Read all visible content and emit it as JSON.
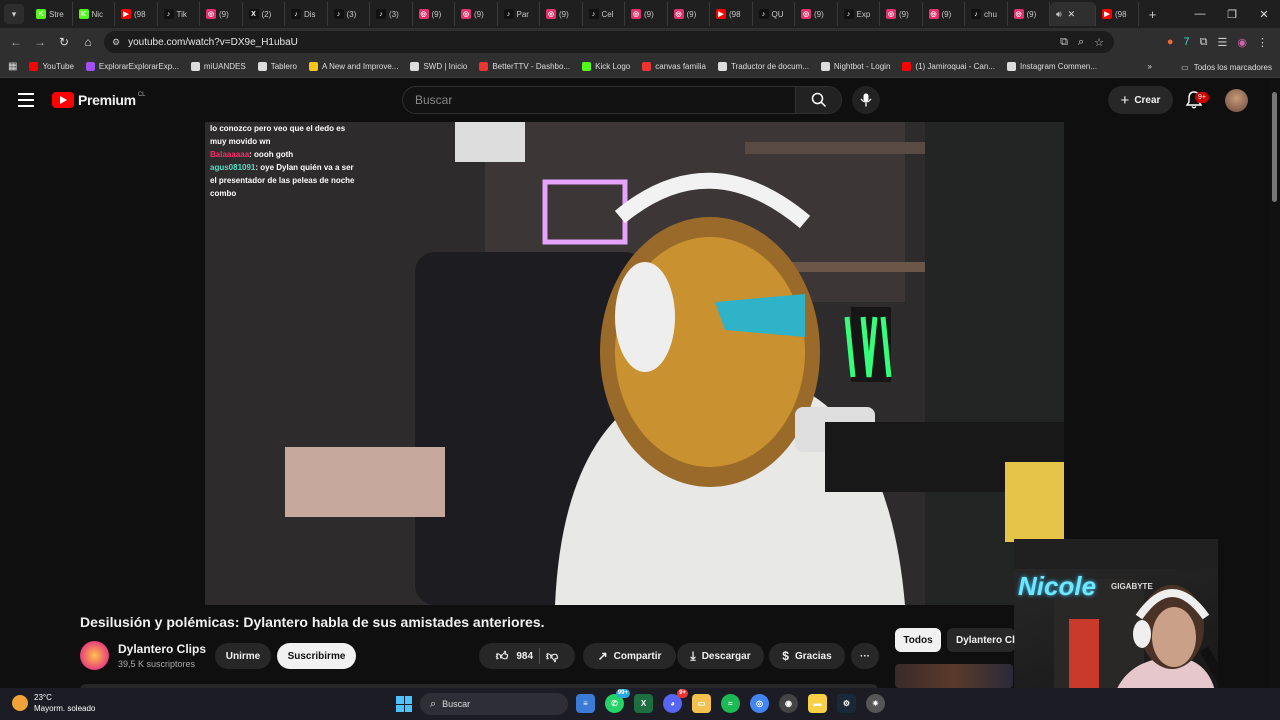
{
  "browser": {
    "tabs": [
      {
        "label": "Stre",
        "icon": "kick-icon",
        "color": "#53fc18"
      },
      {
        "label": "Nic",
        "icon": "kick-icon",
        "color": "#53fc18"
      },
      {
        "label": "(98",
        "icon": "youtube-icon",
        "color": "#ff0000"
      },
      {
        "label": "Tik",
        "icon": "tiktok-icon",
        "color": "#111111"
      },
      {
        "label": "(9)",
        "icon": "instagram-icon",
        "color": "#e1306c"
      },
      {
        "label": "(2)",
        "icon": "x-icon",
        "color": "#111111"
      },
      {
        "label": "Dis",
        "icon": "tiktok-icon",
        "color": "#111111"
      },
      {
        "label": "(3)",
        "icon": "tiktok-icon",
        "color": "#111111"
      },
      {
        "label": "(3)",
        "icon": "tiktok-icon",
        "color": "#111111"
      },
      {
        "label": "(9)",
        "icon": "instagram-icon",
        "color": "#e1306c"
      },
      {
        "label": "(9)",
        "icon": "instagram-icon",
        "color": "#e1306c"
      },
      {
        "label": "Par",
        "icon": "tiktok-icon",
        "color": "#111111"
      },
      {
        "label": "(9)",
        "icon": "instagram-icon",
        "color": "#e1306c"
      },
      {
        "label": "Cel",
        "icon": "tiktok-icon",
        "color": "#111111"
      },
      {
        "label": "(9)",
        "icon": "instagram-icon",
        "color": "#e1306c"
      },
      {
        "label": "(9)",
        "icon": "instagram-icon",
        "color": "#e1306c"
      },
      {
        "label": "(98",
        "icon": "youtube-icon",
        "color": "#ff0000"
      },
      {
        "label": "QU",
        "icon": "tiktok-icon",
        "color": "#111111"
      },
      {
        "label": "(9)",
        "icon": "instagram-icon",
        "color": "#e1306c"
      },
      {
        "label": "Exp",
        "icon": "tiktok-icon",
        "color": "#111111"
      },
      {
        "label": "(9)",
        "icon": "instagram-icon",
        "color": "#e1306c"
      },
      {
        "label": "(9)",
        "icon": "instagram-icon",
        "color": "#e1306c"
      },
      {
        "label": "chu",
        "icon": "tiktok-icon",
        "color": "#111111"
      },
      {
        "label": "(9)",
        "icon": "instagram-icon",
        "color": "#e1306c"
      }
    ],
    "active_tab_icon": "audio-icon",
    "last_tab": {
      "label": "(98",
      "icon": "youtube-icon",
      "color": "#ff0000"
    },
    "url": "youtube.com/watch?v=DX9e_H1ubaU",
    "bookmarks": [
      {
        "label": "YouTube",
        "color": "#ff0000"
      },
      {
        "label": "ExplorarExplorarExp...",
        "color": "#a14ff0"
      },
      {
        "label": "miUANDES",
        "color": "#dddddd"
      },
      {
        "label": "Tablero",
        "color": "#dddddd"
      },
      {
        "label": "A New and Improve...",
        "color": "#f5c518"
      },
      {
        "label": "SWD | Inicio",
        "color": "#dddddd"
      },
      {
        "label": "BetterTTV - Dashbo...",
        "color": "#e33"
      },
      {
        "label": "Kick Logo",
        "color": "#53fc18"
      },
      {
        "label": "canvas familia",
        "color": "#e33"
      },
      {
        "label": "Traductor de docum...",
        "color": "#dddddd"
      },
      {
        "label": "Nightbot - Login",
        "color": "#dddddd"
      },
      {
        "label": "(1) Jamiroquai - Can...",
        "color": "#ff0000"
      },
      {
        "label": "Instagram Commen...",
        "color": "#dddddd"
      }
    ],
    "all_bookmarks": "Todos los marcadores"
  },
  "youtube": {
    "logo_text": "Premium",
    "country": "CL",
    "search_placeholder": "Buscar",
    "create_label": "Crear",
    "notif_badge": "9+"
  },
  "video": {
    "chat": [
      {
        "user": "",
        "text": "lo conozco pero veo que el dedo es"
      },
      {
        "user": "",
        "text": "muy movido wn"
      },
      {
        "user": "Balaaaaaa",
        "text": ": oooh goth"
      },
      {
        "user": "agus081091",
        "text": ": oye Dylan quién va a ser"
      },
      {
        "user": "",
        "text": "el presentador de las peleas de noche"
      },
      {
        "user": "",
        "text": "combo"
      }
    ],
    "title": "Desilusión y polémicas: Dylantero habla de sus amistades anteriores.",
    "channel": "Dylantero Clips",
    "subscribers": "39,5 K suscriptores",
    "unsubscribe_label": "Unirme",
    "subscribe_label": "Suscribirme",
    "likes": "984",
    "share_label": "Compartir",
    "download_label": "Descargar",
    "thanks_label": "Gracias"
  },
  "webcam": {
    "logo": "Nicole",
    "brand": "GIGABYTE"
  },
  "chips": {
    "all": "Todos",
    "channel": "Dylantero Cli"
  },
  "taskbar": {
    "temp": "23°C",
    "weather": "Mayorm. soleado",
    "search": "Buscar",
    "whatsapp_badge": "99+",
    "discord_badge": "9+"
  }
}
